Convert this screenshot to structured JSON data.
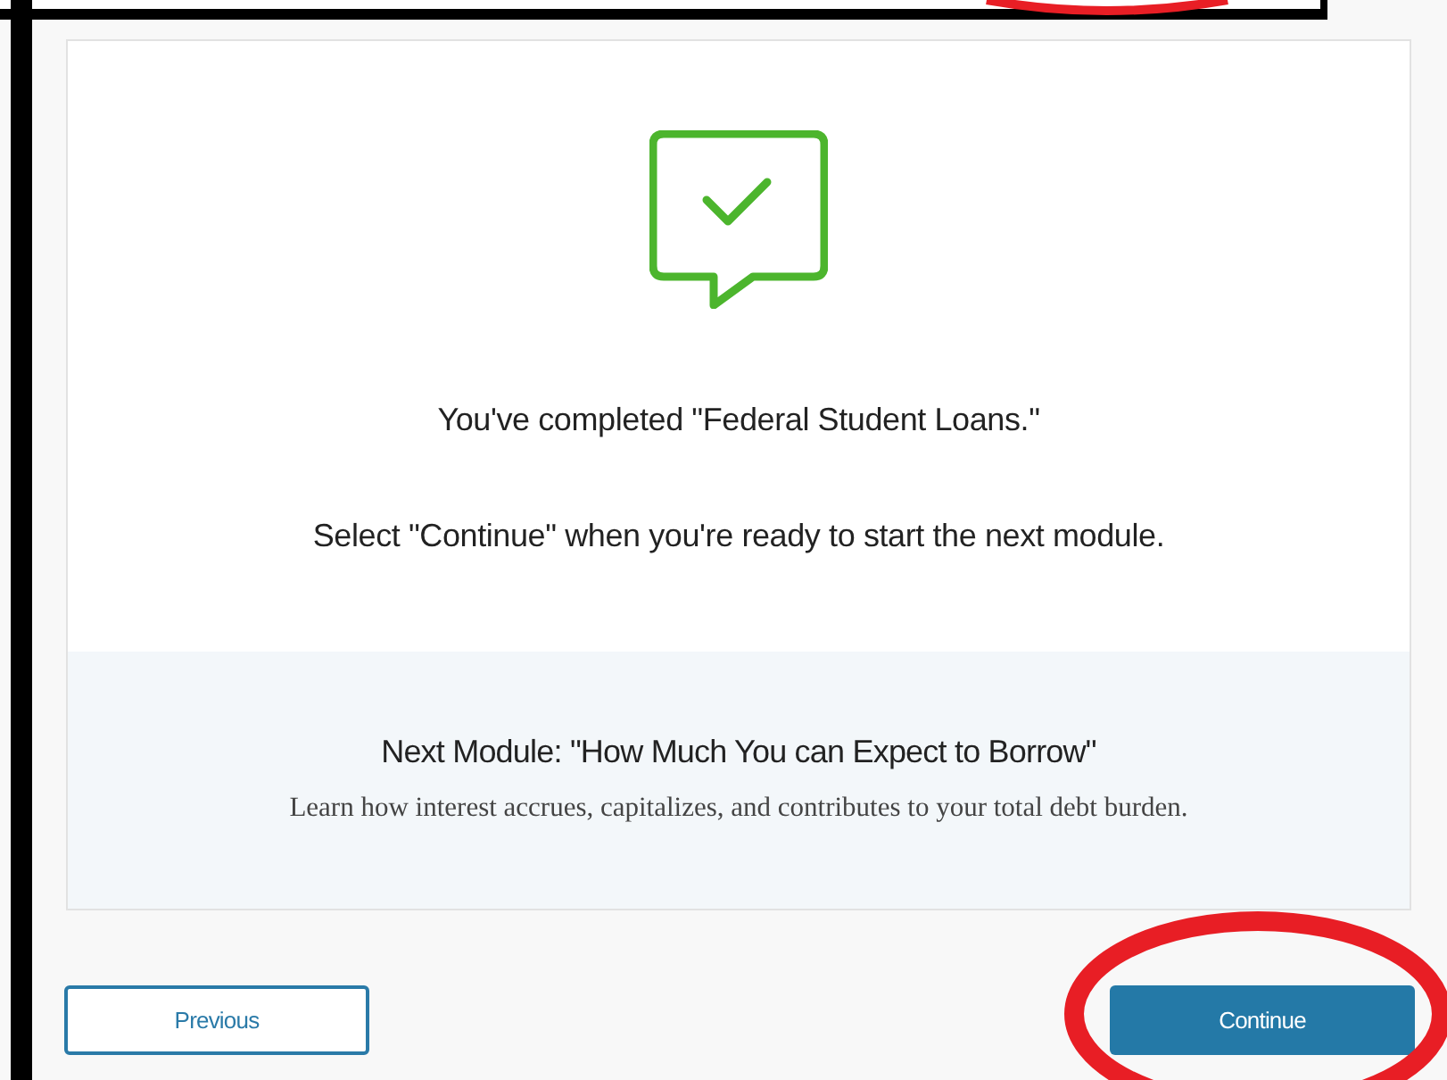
{
  "completion": {
    "title": "You've completed \"Federal Student Loans.\"",
    "instruction": "Select \"Continue\" when you're ready to start the next module."
  },
  "next_module": {
    "title": "Next Module: \"How Much You can Expect to Borrow\"",
    "description": "Learn how interest accrues, capitalizes, and contributes to your total debt burden."
  },
  "buttons": [
    {
      "label": "Previous",
      "kind": "secondary"
    },
    {
      "label": "Continue",
      "kind": "primary"
    }
  ]
}
